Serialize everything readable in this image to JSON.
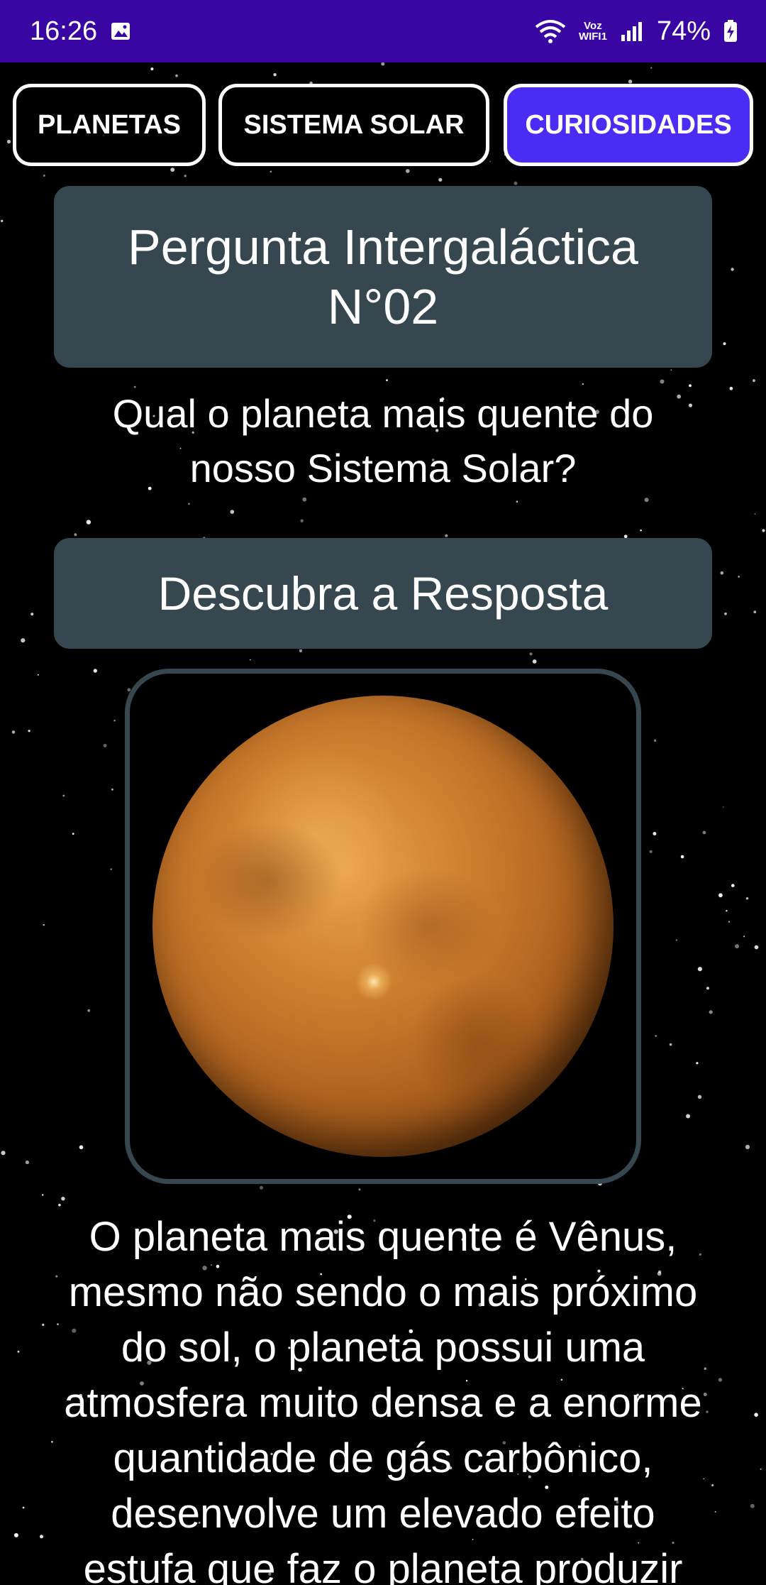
{
  "status_bar": {
    "time": "16:26",
    "gallery_icon": "image-icon",
    "wifi_icon": "wifi-icon",
    "voz_label": "Voz",
    "wifi_label": "WIFI1",
    "signal_icon": "signal-bars-icon",
    "battery_percent": "74%",
    "battery_icon": "battery-charging-icon"
  },
  "tabs": [
    {
      "label": "PLANETAS",
      "active": false
    },
    {
      "label": "SISTEMA SOLAR",
      "active": false
    },
    {
      "label": "CURIOSIDADES",
      "active": true
    }
  ],
  "question_card": {
    "title_line1": "Pergunta Intergaláctica",
    "title_line2": "N°02"
  },
  "question": {
    "line1": "Qual o planeta mais quente do",
    "line2": "nosso Sistema Solar?"
  },
  "reveal_button": "Descubra a Resposta",
  "planet_image": "venus-image",
  "answer_lines": [
    "O planeta mais quente é Vênus,",
    "mesmo não sendo o mais próximo",
    "do sol, o planeta possui uma",
    "atmosfera muito densa e a enorme",
    "quantidade de gás carbônico,",
    "desenvolve um elevado efeito",
    "estufa que faz o planeta produzir"
  ],
  "colors": {
    "status_bar": "#3a06a3",
    "tab_active": "#4a2cf5",
    "card": "#37474f",
    "background": "#000000"
  }
}
